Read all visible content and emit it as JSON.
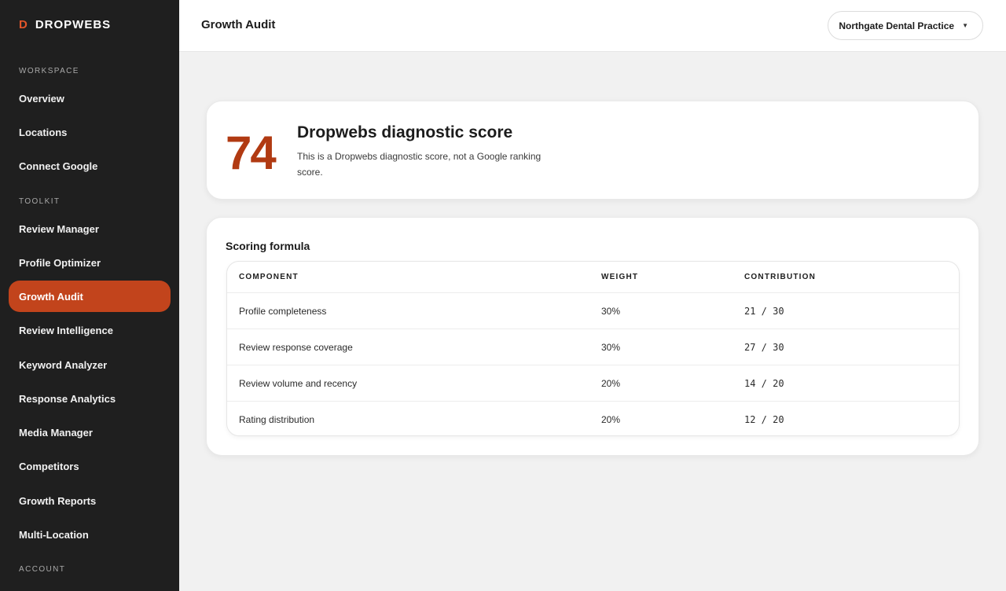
{
  "brand": {
    "mark": "D",
    "name": "DROPWEBS"
  },
  "sidebar": {
    "sections": [
      {
        "label": "WORKSPACE",
        "items": [
          {
            "label": "Overview"
          },
          {
            "label": "Locations"
          },
          {
            "label": "Connect Google"
          }
        ]
      },
      {
        "label": "TOOLKIT",
        "items": [
          {
            "label": "Review Manager"
          },
          {
            "label": "Profile Optimizer"
          },
          {
            "label": "Growth Audit",
            "active": true
          },
          {
            "label": "Review Intelligence"
          },
          {
            "label": "Keyword Analyzer"
          },
          {
            "label": "Response Analytics"
          },
          {
            "label": "Media Manager"
          },
          {
            "label": "Competitors"
          },
          {
            "label": "Growth Reports"
          },
          {
            "label": "Multi-Location"
          }
        ]
      },
      {
        "label": "ACCOUNT",
        "items": []
      }
    ]
  },
  "header": {
    "title": "Growth Audit",
    "location_select": "Northgate Dental Practice"
  },
  "score": {
    "value": "74",
    "title": "Dropwebs diagnostic score",
    "description": "This is a Dropwebs diagnostic score, not a Google ranking score."
  },
  "formula": {
    "title": "Scoring formula",
    "columns": [
      "COMPONENT",
      "WEIGHT",
      "CONTRIBUTION"
    ],
    "rows": [
      {
        "component": "Profile completeness",
        "weight": "30%",
        "contribution": "21 / 30"
      },
      {
        "component": "Review response coverage",
        "weight": "30%",
        "contribution": "27 / 30"
      },
      {
        "component": "Review volume and recency",
        "weight": "20%",
        "contribution": "14 / 20"
      },
      {
        "component": "Rating distribution",
        "weight": "20%",
        "contribution": "12 / 20"
      }
    ]
  },
  "colors": {
    "accent": "#c2441c",
    "score": "#b13a12",
    "sidebar_bg": "#1f1f1f",
    "page_bg": "#f1f1f1"
  }
}
